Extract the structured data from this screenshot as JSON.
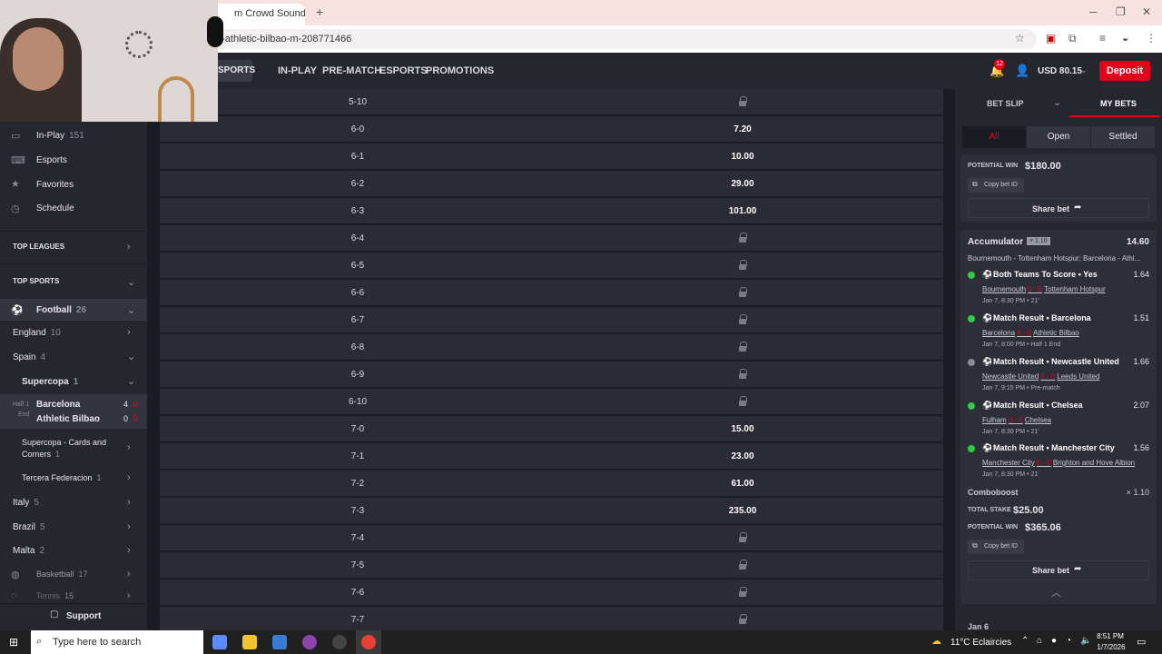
{
  "browser": {
    "tab_title": "m Crowd Sound E",
    "url": "a-athletic-bilbao-m-208771466",
    "new_tab": "+"
  },
  "site": {
    "sports": "SPORTS",
    "nav": [
      "IN-PLAY",
      "PRE-MATCH",
      "ESPORTS",
      "PROMOTIONS"
    ],
    "notif_count": "12",
    "balance": "USD 80.15",
    "deposit": "Deposit"
  },
  "sidebar": {
    "items": [
      {
        "label": "In-Play",
        "count": "151",
        "icon": "tv-icon"
      },
      {
        "label": "Esports",
        "count": "",
        "icon": "gamepad-icon"
      },
      {
        "label": "Favorites",
        "count": "",
        "icon": "star-icon"
      },
      {
        "label": "Schedule",
        "count": "",
        "icon": "clock-icon"
      }
    ],
    "top_leagues": "TOP LEAGUES",
    "top_sports": "TOP SPORTS",
    "football": {
      "label": "Football",
      "count": "26"
    },
    "england": {
      "label": "England",
      "count": "10"
    },
    "spain": {
      "label": "Spain",
      "count": "4"
    },
    "supercopa": {
      "label": "Supercopa",
      "count": "1"
    },
    "live_match": {
      "status1": "Half 1",
      "status2": "End",
      "home": "Barcelona",
      "away": "Athletic Bilbao",
      "home_score": "4",
      "away_score": "0",
      "home_red": "0",
      "away_red": "0"
    },
    "cards_corners": {
      "label": "Supercopa - Cards and Corners",
      "count": "1"
    },
    "tercera": {
      "label": "Tercera Federacion",
      "count": "1"
    },
    "italy": {
      "label": "Italy",
      "count": "5"
    },
    "brazil": {
      "label": "Brazil",
      "count": "5"
    },
    "malta": {
      "label": "Malta",
      "count": "2"
    },
    "basketball": {
      "label": "Basketball",
      "count": "17"
    },
    "tennis": {
      "label": "Tennis",
      "count": "15"
    },
    "support": "Support"
  },
  "scores": [
    {
      "score": "5-10",
      "odds": null
    },
    {
      "score": "6-0",
      "odds": "7.20"
    },
    {
      "score": "6-1",
      "odds": "10.00"
    },
    {
      "score": "6-2",
      "odds": "29.00"
    },
    {
      "score": "6-3",
      "odds": "101.00"
    },
    {
      "score": "6-4",
      "odds": null
    },
    {
      "score": "6-5",
      "odds": null
    },
    {
      "score": "6-6",
      "odds": null
    },
    {
      "score": "6-7",
      "odds": null
    },
    {
      "score": "6-8",
      "odds": null
    },
    {
      "score": "6-9",
      "odds": null
    },
    {
      "score": "6-10",
      "odds": null
    },
    {
      "score": "7-0",
      "odds": "15.00"
    },
    {
      "score": "7-1",
      "odds": "23.00"
    },
    {
      "score": "7-2",
      "odds": "61.00"
    },
    {
      "score": "7-3",
      "odds": "235.00"
    },
    {
      "score": "7-4",
      "odds": null
    },
    {
      "score": "7-5",
      "odds": null
    },
    {
      "score": "7-6",
      "odds": null
    },
    {
      "score": "7-7",
      "odds": null
    }
  ],
  "betslip": {
    "tab_slip": "BET SLIP",
    "tab_mybets": "MY BETS",
    "filters": [
      "All",
      "Open",
      "Settled"
    ],
    "prev_potential_label": "POTENTIAL WIN",
    "prev_potential": "$180.00",
    "copy_id": "Copy bet ID",
    "share": "Share bet",
    "acc_title": "Accumulator",
    "acc_badge": "× 1.10",
    "acc_odds": "14.60",
    "acc_teams": "Bournemouth - Tottenham Hotspur; Barcelona - Athl...",
    "legs": [
      {
        "market": "Both Teams To Score",
        "pick": "Yes",
        "odds": "1.64",
        "home": "Bournemouth",
        "score": "0 - 0",
        "away": "Tottenham Hotspur",
        "time": "Jan 7, 8:30 PM",
        "status": "21'",
        "dot": "#2ecc40"
      },
      {
        "market": "Match Result",
        "pick": "Barcelona",
        "odds": "1.51",
        "home": "Barcelona",
        "score": "4 - 0",
        "away": "Athletic Bilbao",
        "time": "Jan 7, 8:00 PM",
        "status": "Half 1 End",
        "dot": "#2ecc40"
      },
      {
        "market": "Match Result",
        "pick": "Newcastle United",
        "odds": "1.66",
        "home": "Newcastle United",
        "score": "0 - 0",
        "away": "Leeds United",
        "time": "Jan 7, 9:15 PM",
        "status": "Pre-match",
        "dot": "#8a8a96"
      },
      {
        "market": "Match Result",
        "pick": "Chelsea",
        "odds": "2.07",
        "home": "Fulham",
        "score": "0 - 0",
        "away": "Chelsea",
        "time": "Jan 7, 8:30 PM",
        "status": "21'",
        "dot": "#2ecc40"
      },
      {
        "market": "Match Result",
        "pick": "Manchester City",
        "odds": "1.56",
        "home": "Manchester City",
        "score": "0 - 0",
        "away": "Brighton and Hove Albion",
        "time": "Jan 7, 8:30 PM",
        "status": "21'",
        "dot": "#2ecc40"
      }
    ],
    "comboboost_label": "Comboboost",
    "comboboost": "× 1.10",
    "stake_label": "TOTAL STAKE",
    "stake": "$25.00",
    "potential_label": "POTENTIAL WIN",
    "potential": "$365.06",
    "next_date": "Jan 6"
  },
  "taskbar": {
    "search": "Type here to search",
    "weather": "11°C  Eclaircies",
    "time": "8:51 PM",
    "date": "1/7/2026"
  },
  "colors": {
    "accent": "#e3001b",
    "win": "#2ecc40"
  }
}
